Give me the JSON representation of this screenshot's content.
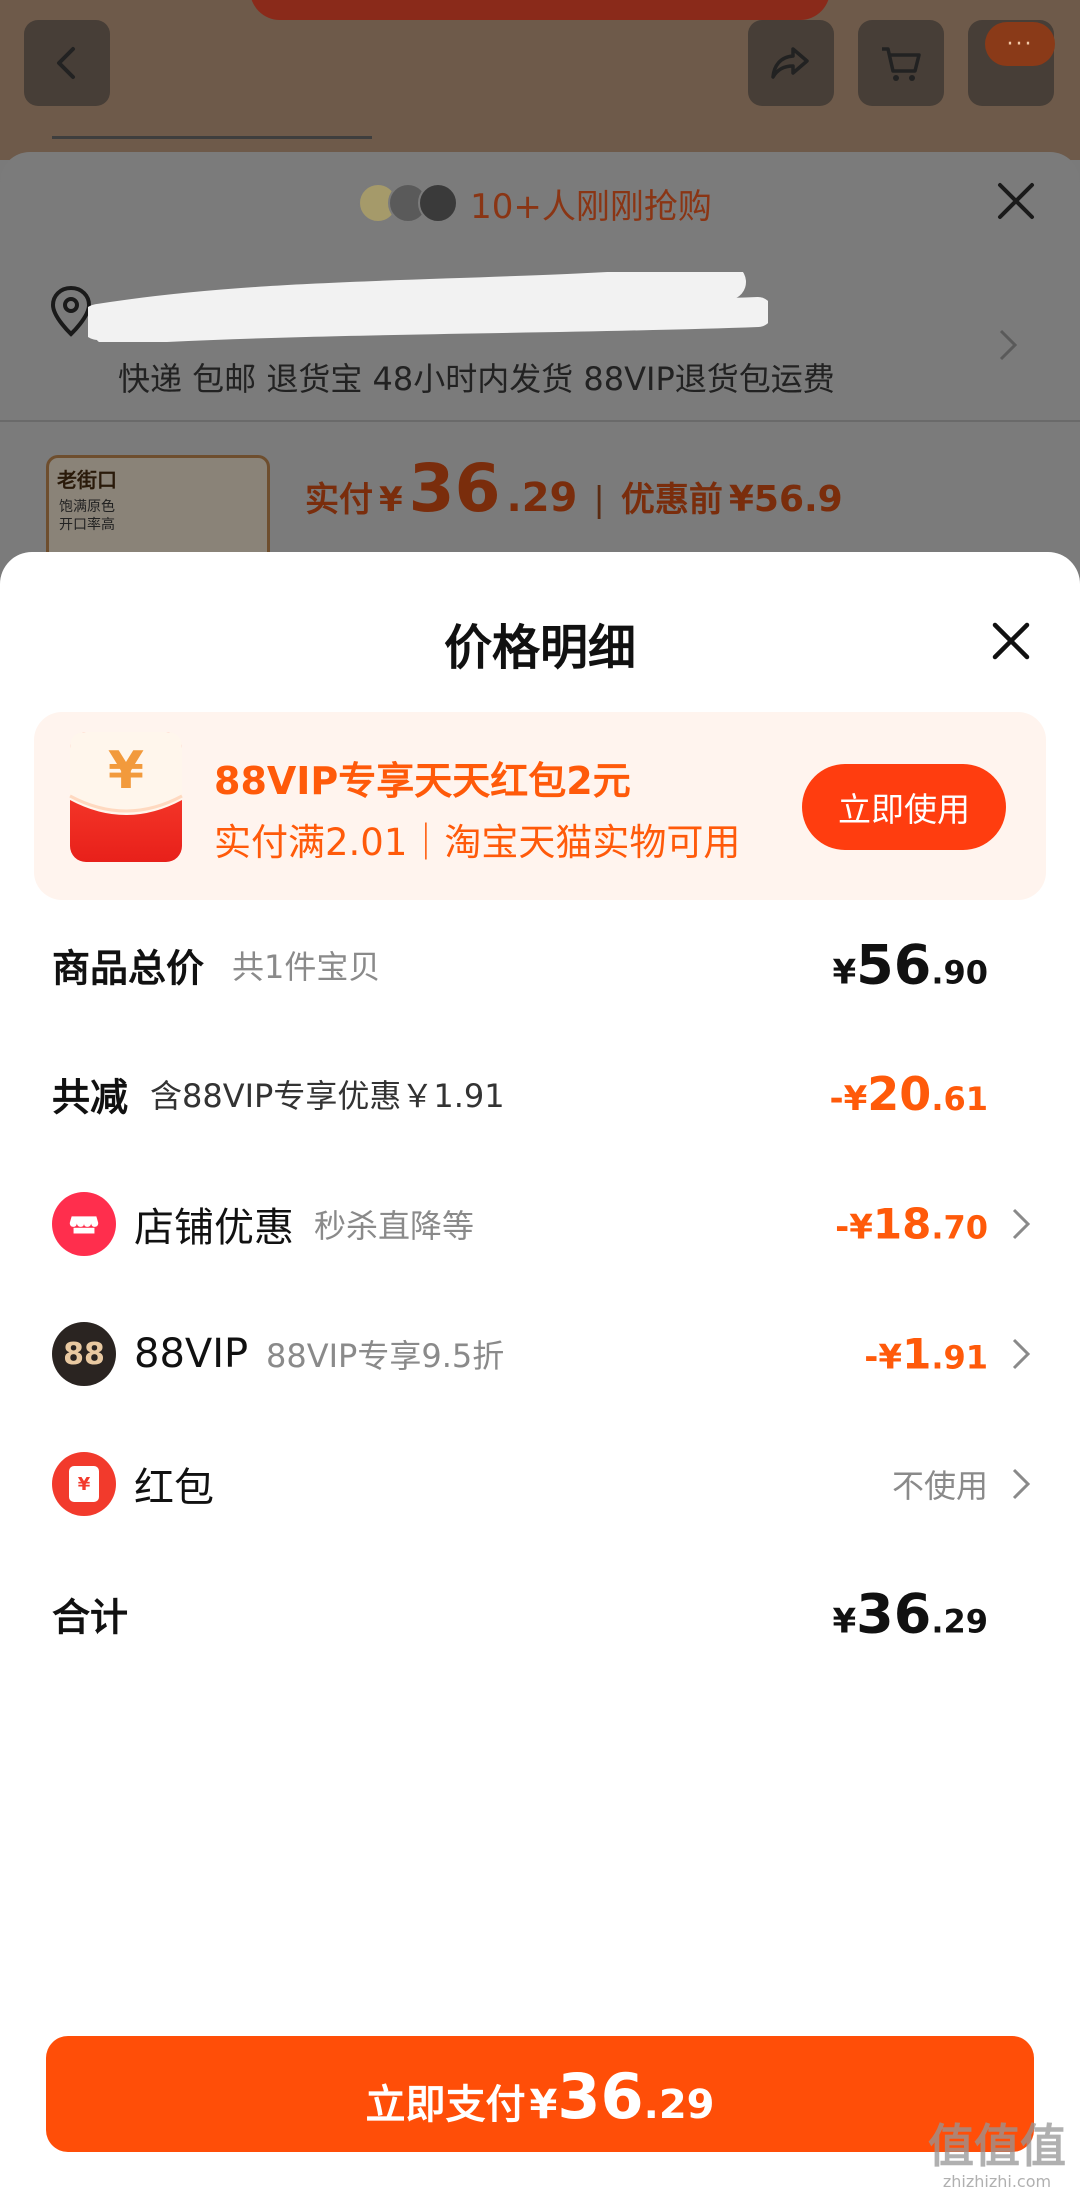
{
  "background": {
    "more_badge": "···",
    "buyers_text": "10+人刚刚抢购",
    "delivery_text": "快递 包邮 退货宝 48小时内发货 88VIP退货包运费",
    "product": {
      "brand": "老街口",
      "thumb_caption": "饱满原色\n开口率高",
      "paid_label": "实付",
      "currency": "¥",
      "paid_int": "36",
      "paid_dec": ".29",
      "orig_label": "优惠前",
      "orig_price": "¥56.9"
    }
  },
  "sheet": {
    "title": "价格明细",
    "promo": {
      "title": "88VIP专享天天红包2元",
      "subtitle": "实付满2.01｜淘宝天猫实物可用",
      "button": "立即使用"
    },
    "rows": {
      "goods_total": {
        "label": "商品总价",
        "hint": "共1件宝贝",
        "currency": "¥",
        "int": "56",
        "dec": ".90"
      },
      "discount_total": {
        "label": "共减",
        "hint": "含88VIP专享优惠￥1.91",
        "currency": "-¥",
        "int": "20",
        "dec": ".61"
      },
      "store_discount": {
        "label": "店铺优惠",
        "hint": "秒杀直降等",
        "currency": "-¥",
        "int": "18",
        "dec": ".70"
      },
      "vip": {
        "label": "88VIP",
        "hint": "88VIP专享9.5折",
        "icon_text": "88",
        "currency": "-¥",
        "int": "1",
        "dec": ".91"
      },
      "red_packet": {
        "label": "红包",
        "value": "不使用",
        "icon_text": "¥"
      },
      "total": {
        "label": "合计",
        "currency": "¥",
        "int": "36",
        "dec": ".29"
      }
    },
    "pay_button": {
      "label": "立即支付",
      "currency": "¥",
      "int": "36",
      "dec": ".29"
    }
  },
  "watermark": {
    "main": "值值值",
    "sub": "zhizhizhi.com"
  },
  "colors": {
    "accent": "#ff5a0a",
    "pay_button": "#ff4e08",
    "promo_bg": "#fff4ee",
    "store_icon": "#ff2e4d",
    "redpacket_icon": "#f23a2c"
  }
}
